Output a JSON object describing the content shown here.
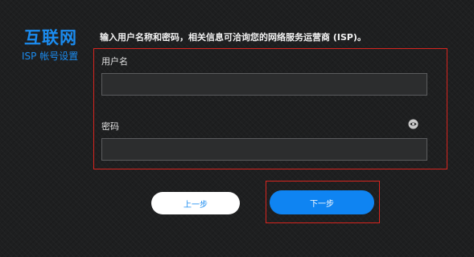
{
  "brand": {
    "title": "互联网",
    "subtitle": "ISP 帐号设置"
  },
  "instruction": "输入用户名称和密码，相关信息可洽询您的网络服务运营商 (ISP)。",
  "form": {
    "username": {
      "label": "用户名",
      "value": "",
      "placeholder": ""
    },
    "password": {
      "label": "密码",
      "value": "",
      "placeholder": "",
      "toggle_icon": "eye-icon"
    }
  },
  "buttons": {
    "prev_label": "上一步",
    "next_label": "下一步"
  },
  "colors": {
    "accent": "#1b8cf0",
    "highlight": "#d8251f",
    "background": "#1e1f20"
  }
}
